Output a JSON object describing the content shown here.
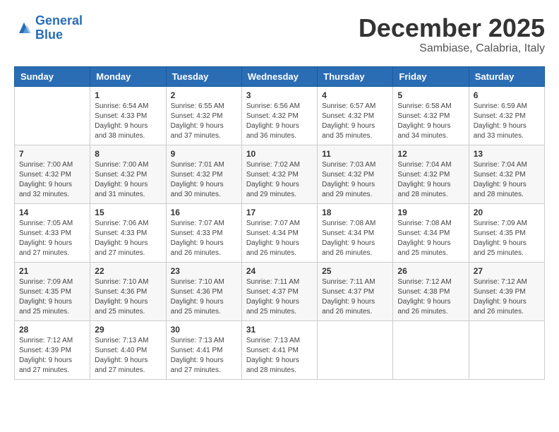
{
  "header": {
    "logo_line1": "General",
    "logo_line2": "Blue",
    "month_title": "December 2025",
    "location": "Sambiase, Calabria, Italy"
  },
  "weekdays": [
    "Sunday",
    "Monday",
    "Tuesday",
    "Wednesday",
    "Thursday",
    "Friday",
    "Saturday"
  ],
  "weeks": [
    [
      {
        "day": "",
        "sunrise": "",
        "sunset": "",
        "daylight": ""
      },
      {
        "day": "1",
        "sunrise": "Sunrise: 6:54 AM",
        "sunset": "Sunset: 4:33 PM",
        "daylight": "Daylight: 9 hours and 38 minutes."
      },
      {
        "day": "2",
        "sunrise": "Sunrise: 6:55 AM",
        "sunset": "Sunset: 4:32 PM",
        "daylight": "Daylight: 9 hours and 37 minutes."
      },
      {
        "day": "3",
        "sunrise": "Sunrise: 6:56 AM",
        "sunset": "Sunset: 4:32 PM",
        "daylight": "Daylight: 9 hours and 36 minutes."
      },
      {
        "day": "4",
        "sunrise": "Sunrise: 6:57 AM",
        "sunset": "Sunset: 4:32 PM",
        "daylight": "Daylight: 9 hours and 35 minutes."
      },
      {
        "day": "5",
        "sunrise": "Sunrise: 6:58 AM",
        "sunset": "Sunset: 4:32 PM",
        "daylight": "Daylight: 9 hours and 34 minutes."
      },
      {
        "day": "6",
        "sunrise": "Sunrise: 6:59 AM",
        "sunset": "Sunset: 4:32 PM",
        "daylight": "Daylight: 9 hours and 33 minutes."
      }
    ],
    [
      {
        "day": "7",
        "sunrise": "Sunrise: 7:00 AM",
        "sunset": "Sunset: 4:32 PM",
        "daylight": "Daylight: 9 hours and 32 minutes."
      },
      {
        "day": "8",
        "sunrise": "Sunrise: 7:00 AM",
        "sunset": "Sunset: 4:32 PM",
        "daylight": "Daylight: 9 hours and 31 minutes."
      },
      {
        "day": "9",
        "sunrise": "Sunrise: 7:01 AM",
        "sunset": "Sunset: 4:32 PM",
        "daylight": "Daylight: 9 hours and 30 minutes."
      },
      {
        "day": "10",
        "sunrise": "Sunrise: 7:02 AM",
        "sunset": "Sunset: 4:32 PM",
        "daylight": "Daylight: 9 hours and 29 minutes."
      },
      {
        "day": "11",
        "sunrise": "Sunrise: 7:03 AM",
        "sunset": "Sunset: 4:32 PM",
        "daylight": "Daylight: 9 hours and 29 minutes."
      },
      {
        "day": "12",
        "sunrise": "Sunrise: 7:04 AM",
        "sunset": "Sunset: 4:32 PM",
        "daylight": "Daylight: 9 hours and 28 minutes."
      },
      {
        "day": "13",
        "sunrise": "Sunrise: 7:04 AM",
        "sunset": "Sunset: 4:32 PM",
        "daylight": "Daylight: 9 hours and 28 minutes."
      }
    ],
    [
      {
        "day": "14",
        "sunrise": "Sunrise: 7:05 AM",
        "sunset": "Sunset: 4:33 PM",
        "daylight": "Daylight: 9 hours and 27 minutes."
      },
      {
        "day": "15",
        "sunrise": "Sunrise: 7:06 AM",
        "sunset": "Sunset: 4:33 PM",
        "daylight": "Daylight: 9 hours and 27 minutes."
      },
      {
        "day": "16",
        "sunrise": "Sunrise: 7:07 AM",
        "sunset": "Sunset: 4:33 PM",
        "daylight": "Daylight: 9 hours and 26 minutes."
      },
      {
        "day": "17",
        "sunrise": "Sunrise: 7:07 AM",
        "sunset": "Sunset: 4:34 PM",
        "daylight": "Daylight: 9 hours and 26 minutes."
      },
      {
        "day": "18",
        "sunrise": "Sunrise: 7:08 AM",
        "sunset": "Sunset: 4:34 PM",
        "daylight": "Daylight: 9 hours and 26 minutes."
      },
      {
        "day": "19",
        "sunrise": "Sunrise: 7:08 AM",
        "sunset": "Sunset: 4:34 PM",
        "daylight": "Daylight: 9 hours and 25 minutes."
      },
      {
        "day": "20",
        "sunrise": "Sunrise: 7:09 AM",
        "sunset": "Sunset: 4:35 PM",
        "daylight": "Daylight: 9 hours and 25 minutes."
      }
    ],
    [
      {
        "day": "21",
        "sunrise": "Sunrise: 7:09 AM",
        "sunset": "Sunset: 4:35 PM",
        "daylight": "Daylight: 9 hours and 25 minutes."
      },
      {
        "day": "22",
        "sunrise": "Sunrise: 7:10 AM",
        "sunset": "Sunset: 4:36 PM",
        "daylight": "Daylight: 9 hours and 25 minutes."
      },
      {
        "day": "23",
        "sunrise": "Sunrise: 7:10 AM",
        "sunset": "Sunset: 4:36 PM",
        "daylight": "Daylight: 9 hours and 25 minutes."
      },
      {
        "day": "24",
        "sunrise": "Sunrise: 7:11 AM",
        "sunset": "Sunset: 4:37 PM",
        "daylight": "Daylight: 9 hours and 25 minutes."
      },
      {
        "day": "25",
        "sunrise": "Sunrise: 7:11 AM",
        "sunset": "Sunset: 4:37 PM",
        "daylight": "Daylight: 9 hours and 26 minutes."
      },
      {
        "day": "26",
        "sunrise": "Sunrise: 7:12 AM",
        "sunset": "Sunset: 4:38 PM",
        "daylight": "Daylight: 9 hours and 26 minutes."
      },
      {
        "day": "27",
        "sunrise": "Sunrise: 7:12 AM",
        "sunset": "Sunset: 4:39 PM",
        "daylight": "Daylight: 9 hours and 26 minutes."
      }
    ],
    [
      {
        "day": "28",
        "sunrise": "Sunrise: 7:12 AM",
        "sunset": "Sunset: 4:39 PM",
        "daylight": "Daylight: 9 hours and 27 minutes."
      },
      {
        "day": "29",
        "sunrise": "Sunrise: 7:13 AM",
        "sunset": "Sunset: 4:40 PM",
        "daylight": "Daylight: 9 hours and 27 minutes."
      },
      {
        "day": "30",
        "sunrise": "Sunrise: 7:13 AM",
        "sunset": "Sunset: 4:41 PM",
        "daylight": "Daylight: 9 hours and 27 minutes."
      },
      {
        "day": "31",
        "sunrise": "Sunrise: 7:13 AM",
        "sunset": "Sunset: 4:41 PM",
        "daylight": "Daylight: 9 hours and 28 minutes."
      },
      {
        "day": "",
        "sunrise": "",
        "sunset": "",
        "daylight": ""
      },
      {
        "day": "",
        "sunrise": "",
        "sunset": "",
        "daylight": ""
      },
      {
        "day": "",
        "sunrise": "",
        "sunset": "",
        "daylight": ""
      }
    ]
  ]
}
